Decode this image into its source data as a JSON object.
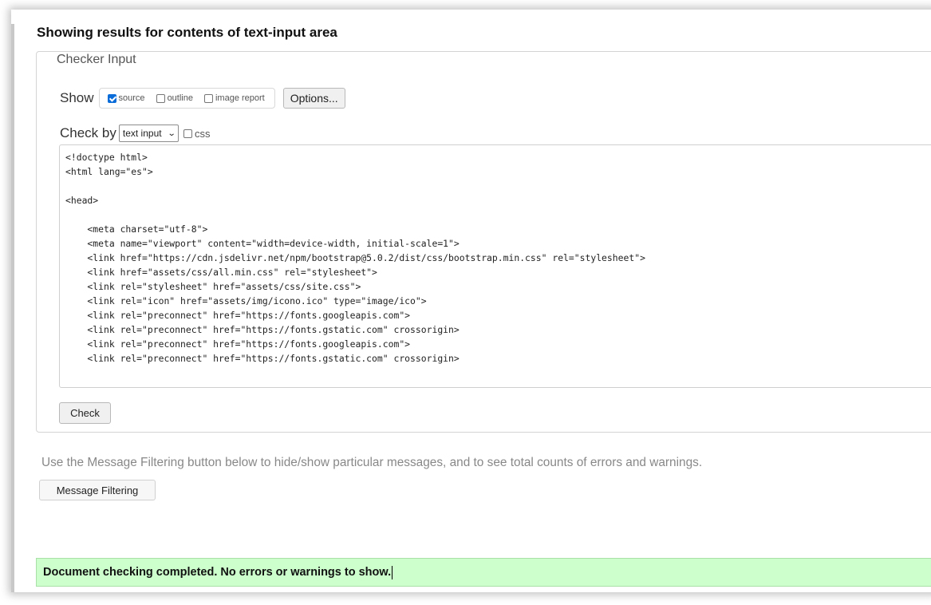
{
  "heading": "Showing results for contents of text-input area",
  "checker": {
    "legend": "Checker Input",
    "show_label": "Show",
    "show_options": [
      {
        "label": "source",
        "checked": true
      },
      {
        "label": "outline",
        "checked": false
      },
      {
        "label": "image report",
        "checked": false
      }
    ],
    "options_button": "Options...",
    "check_by_label": "Check by",
    "check_by_value": "text input",
    "css_label": "css",
    "css_checked": false,
    "source_lines": [
      "<!doctype html>",
      "<html lang=\"es\">",
      "",
      "<head>",
      "",
      "    <meta charset=\"utf-8\">",
      "    <meta name=\"viewport\" content=\"width=device-width, initial-scale=1\">",
      "    <link href=\"https://cdn.jsdelivr.net/npm/bootstrap@5.0.2/dist/css/bootstrap.min.css\" rel=\"stylesheet\">",
      "    <link href=\"assets/css/all.min.css\" rel=\"stylesheet\">",
      "    <link rel=\"stylesheet\" href=\"assets/css/site.css\">",
      "    <link rel=\"icon\" href=\"assets/img/icono.ico\" type=\"image/ico\">",
      "    <link rel=\"preconnect\" href=\"https://fonts.googleapis.com\">",
      "    <link rel=\"preconnect\" href=\"https://fonts.gstatic.com\" crossorigin>",
      "    <link rel=\"preconnect\" href=\"https://fonts.googleapis.com\">",
      "    <link rel=\"preconnect\" href=\"https://fonts.gstatic.com\" crossorigin>"
    ],
    "check_button": "Check"
  },
  "filtering": {
    "info": "Use the Message Filtering button below to hide/show particular messages, and to see total counts of errors and warnings.",
    "button": "Message Filtering"
  },
  "status": {
    "message": "Document checking completed. No errors or warnings to show.",
    "color": "#ccffcc"
  },
  "colors": {
    "checkbox_accent": "#0a6cd8"
  }
}
